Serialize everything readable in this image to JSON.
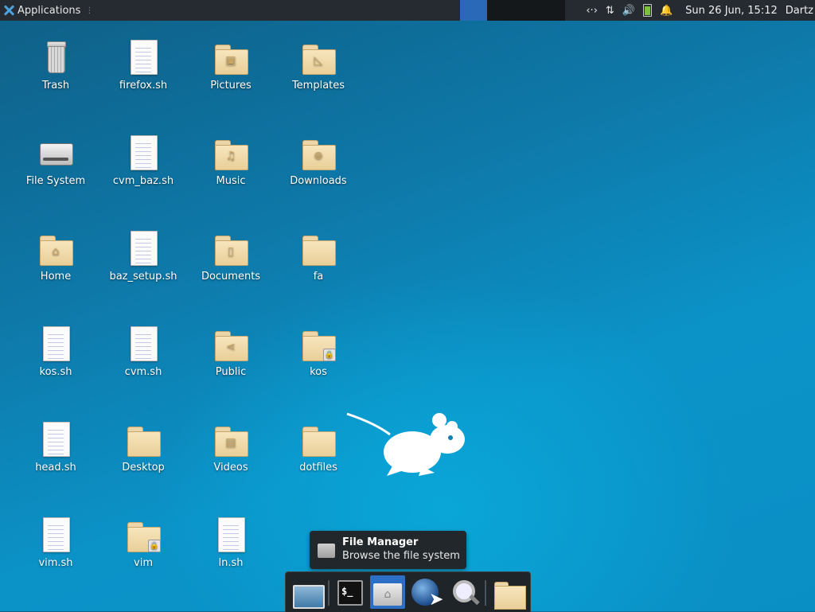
{
  "panel": {
    "apps_label": "Applications",
    "grip": "⋮",
    "tray": {
      "network": "‹·›",
      "transfer": "⇅",
      "volume": "🔊",
      "notifications": "🔔"
    },
    "clock": "Sun 26 Jun, 15:12",
    "user": "Dartz"
  },
  "desktop": {
    "icons": [
      {
        "label": "Trash",
        "type": "trash"
      },
      {
        "label": "firefox.sh",
        "type": "document"
      },
      {
        "label": "Pictures",
        "type": "folder"
      },
      {
        "label": "Templates",
        "type": "folder"
      },
      {
        "label": "File System",
        "type": "drive"
      },
      {
        "label": "cvm_baz.sh",
        "type": "document"
      },
      {
        "label": "Music",
        "type": "folder"
      },
      {
        "label": "Downloads",
        "type": "folder"
      },
      {
        "label": "Home",
        "type": "folder"
      },
      {
        "label": "baz_setup.sh",
        "type": "document"
      },
      {
        "label": "Documents",
        "type": "folder"
      },
      {
        "label": "fa",
        "type": "folder"
      },
      {
        "label": "kos.sh",
        "type": "document"
      },
      {
        "label": "cvm.sh",
        "type": "document"
      },
      {
        "label": "Public",
        "type": "folder"
      },
      {
        "label": "kos",
        "type": "folder-locked"
      },
      {
        "label": "head.sh",
        "type": "document"
      },
      {
        "label": "Desktop",
        "type": "folder"
      },
      {
        "label": "Videos",
        "type": "folder"
      },
      {
        "label": "dotfiles",
        "type": "folder"
      },
      {
        "label": "vim.sh",
        "type": "document"
      },
      {
        "label": "vim",
        "type": "folder-locked"
      },
      {
        "label": "ln.sh",
        "type": "document"
      }
    ]
  },
  "tooltip": {
    "title": "File Manager",
    "subtitle": "Browse the file system"
  },
  "dock": {
    "items": [
      "show-desktop",
      "terminal",
      "file-manager",
      "web-browser",
      "app-finder",
      "folder"
    ],
    "active": "file-manager",
    "terminal_prompt": "$_"
  },
  "colors": {
    "panel_bg": "#252b30",
    "accent": "#2c6fc4",
    "folder": "#f0dcaf"
  }
}
